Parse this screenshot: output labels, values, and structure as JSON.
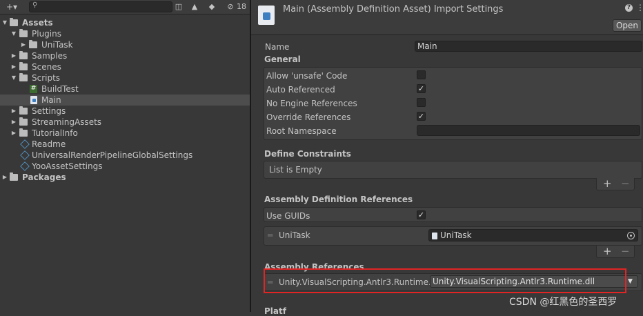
{
  "left": {
    "toolbar": {
      "add_label": "+▾",
      "hidden_count": "18"
    },
    "tree": [
      {
        "label": "Assets",
        "bold": true
      },
      {
        "label": "Plugins"
      },
      {
        "label": "UniTask"
      },
      {
        "label": "Samples"
      },
      {
        "label": "Scenes"
      },
      {
        "label": "Scripts"
      },
      {
        "label": "BuildTest"
      },
      {
        "label": "Main"
      },
      {
        "label": "Settings"
      },
      {
        "label": "StreamingAssets"
      },
      {
        "label": "TutorialInfo"
      },
      {
        "label": "Readme"
      },
      {
        "label": "UniversalRenderPipelineGlobalSettings"
      },
      {
        "label": "YooAssetSettings"
      },
      {
        "label": "Packages",
        "bold": true
      }
    ]
  },
  "inspector": {
    "title": "Main (Assembly Definition Asset) Import Settings",
    "open_label": "Open",
    "name_label": "Name",
    "name_value": "Main",
    "general": {
      "heading": "General",
      "allow_unsafe": {
        "label": "Allow 'unsafe' Code",
        "checked": false
      },
      "auto_referenced": {
        "label": "Auto Referenced",
        "checked": true
      },
      "no_engine_refs": {
        "label": "No Engine References",
        "checked": false
      },
      "override_refs": {
        "label": "Override References",
        "checked": true
      },
      "root_namespace": {
        "label": "Root Namespace",
        "value": ""
      }
    },
    "define_constraints": {
      "heading": "Define Constraints",
      "empty_text": "List is Empty",
      "plus": "+",
      "minus": "−"
    },
    "asmdef_refs": {
      "heading": "Assembly Definition References",
      "use_guids": {
        "label": "Use GUIDs",
        "checked": true
      },
      "items": [
        {
          "label": "UniTask",
          "value": "UniTask"
        }
      ],
      "plus": "+",
      "minus": "−"
    },
    "assembly_refs": {
      "heading": "Assembly References",
      "items": [
        {
          "label": "Unity.VisualScripting.Antlr3.Runtime.dll",
          "value": "Unity.VisualScripting.Antlr3.Runtime.dll"
        }
      ]
    },
    "next_heading_partial": "Platf"
  },
  "highlight_color": "#e32424",
  "watermark": "CSDN @红黑色的圣西罗",
  "icons": [
    "plus-icon",
    "search-icon",
    "folder-icon",
    "script-icon",
    "assembly-definition-icon",
    "scriptable-object-icon",
    "help-icon",
    "menu-icon",
    "target-icon"
  ]
}
